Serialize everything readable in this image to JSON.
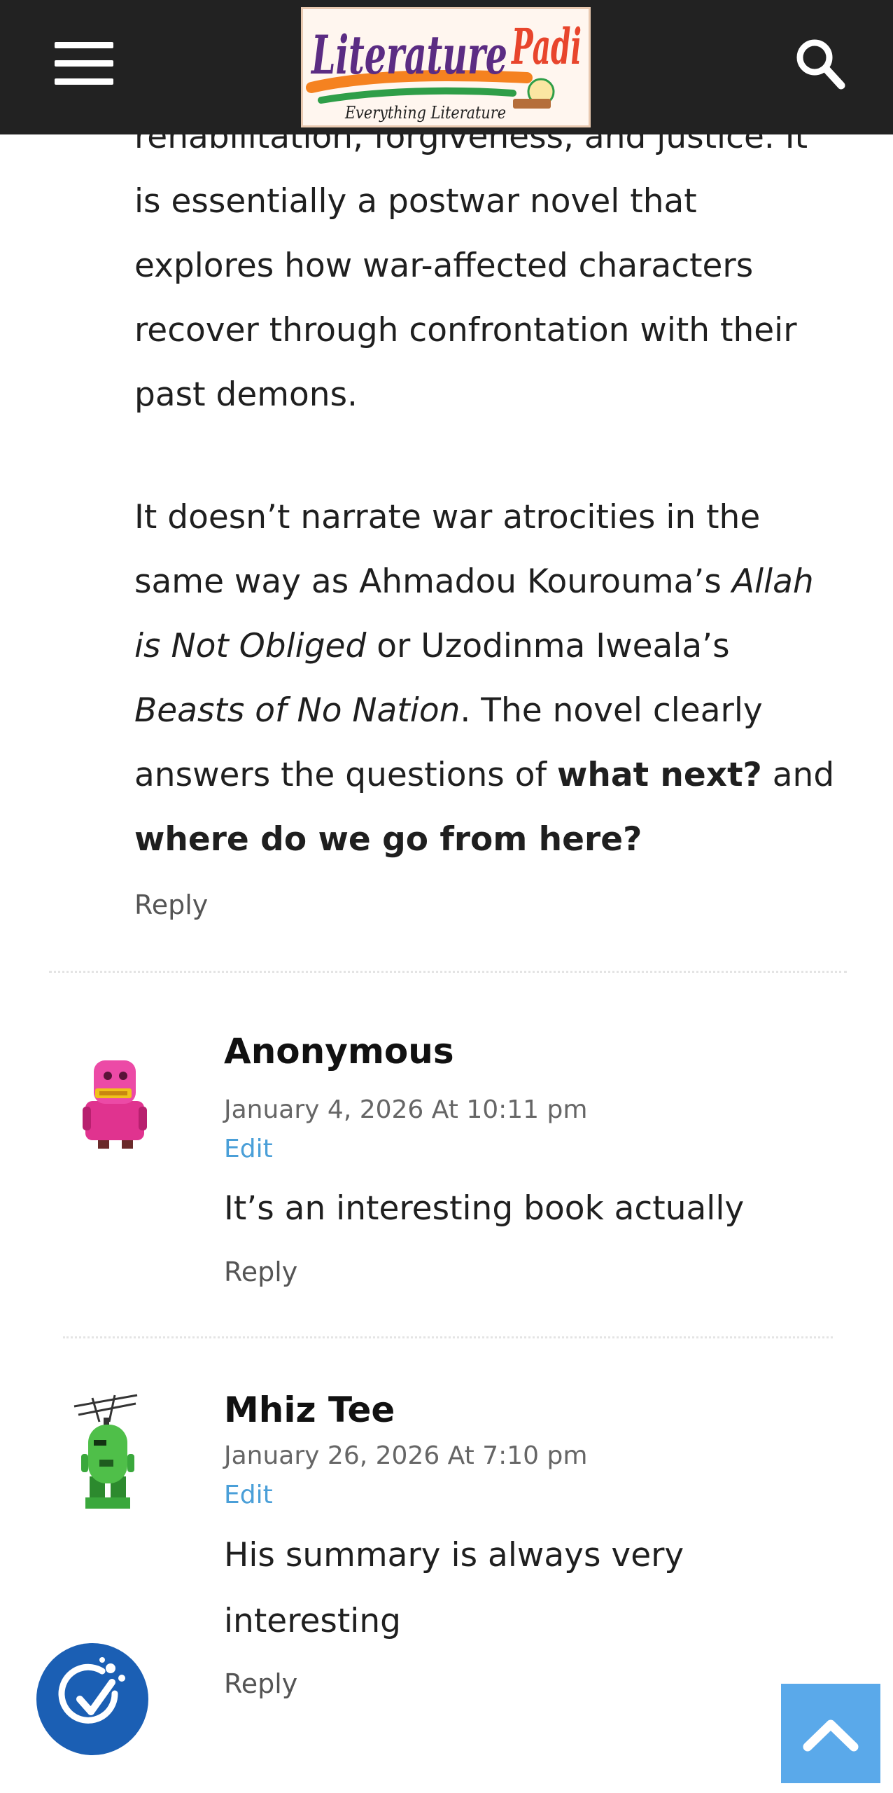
{
  "header": {
    "logo_title": "LiteraturePadi",
    "logo_tagline": "Everything Literature",
    "menu_icon": "hamburger-menu-icon",
    "search_icon": "search-icon"
  },
  "article": {
    "para1_cut_line": "rehabilitation, forgiveness, and justice. It is",
    "para1_rest": "essentially a postwar novel that explores how war-affected characters recover through confrontation with their past demons.",
    "para2": {
      "t1": "It doesn’t narrate war atrocities in the same way as Ahmadou Kourouma’s ",
      "i1": "Allah is Not Obliged",
      "t2": " or Uzodinma Iweala’s ",
      "i2": "Beasts of No Nation",
      "t3": ". The novel clearly answers the questions of ",
      "b1": "what next?",
      "t4": " and ",
      "b2": "where do we go from here?"
    },
    "reply_label": "Reply"
  },
  "comments": [
    {
      "author": "Anonymous",
      "date": "January 4, 2026 At 10:11 pm",
      "edit_label": "Edit",
      "text": "It’s an interesting book actually",
      "reply_label": "Reply",
      "avatar": "pink-robot-avatar"
    },
    {
      "author": "Mhiz Tee",
      "date": "January 26, 2026 At 7:10 pm",
      "edit_label": "Edit",
      "text": "His summary is always very interesting",
      "reply_label": "Reply",
      "avatar": "green-robot-avatar"
    }
  ],
  "floating": {
    "accessibility_icon": "accessibility-check-icon",
    "back_to_top_icon": "chevron-up-icon"
  },
  "colors": {
    "header_bg": "#222222",
    "link_blue": "#4a9fd8",
    "accessibility_bg": "#1b5fb4",
    "back_to_top_bg": "#5aa9ea"
  }
}
